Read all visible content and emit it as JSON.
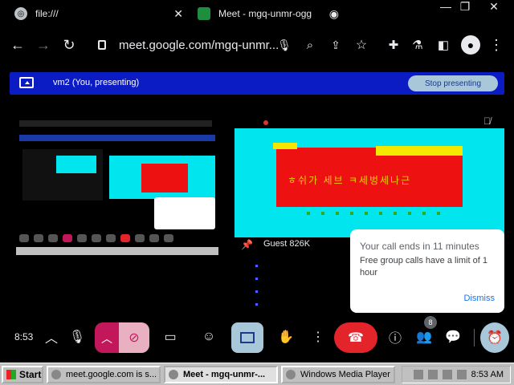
{
  "browser": {
    "tabs": [
      {
        "title": "file:///",
        "close": "✕"
      },
      {
        "title": "Meet - mgq-unmr-ogg",
        "close": "✕"
      }
    ],
    "window_controls": {
      "minimize": "—",
      "restore": "❐",
      "close": "✕"
    },
    "url": "meet.google.com/mgq-unmr..."
  },
  "meet": {
    "banner": {
      "text": "vm2 (You, presenting)",
      "stop_label": "Stop presenting"
    },
    "slide_text": "ㅎ쉬가 세브 ㅋ세벙세나근",
    "guest_name": "Guest 826K",
    "notification": {
      "title": "Your call ends in 11 minutes",
      "body": "Free group calls have a limit of 1 hour",
      "dismiss_label": "Dismiss"
    },
    "controls": {
      "time": "8:53",
      "participants_count": "8"
    }
  },
  "taskbar": {
    "start_label": "Start",
    "tasks": [
      {
        "label": "meet.google.com is s..."
      },
      {
        "label": "Meet - mgq-unmr-..."
      },
      {
        "label": "Windows Media Player"
      }
    ],
    "clock": "8:53 AM"
  },
  "colors": {
    "banner_bg": "#0c1cc5",
    "leave_red": "#e3242b",
    "screen_cyan": "#00e5ee",
    "slide_red": "#ee1111",
    "cam_off_pink": "#c2185b"
  }
}
